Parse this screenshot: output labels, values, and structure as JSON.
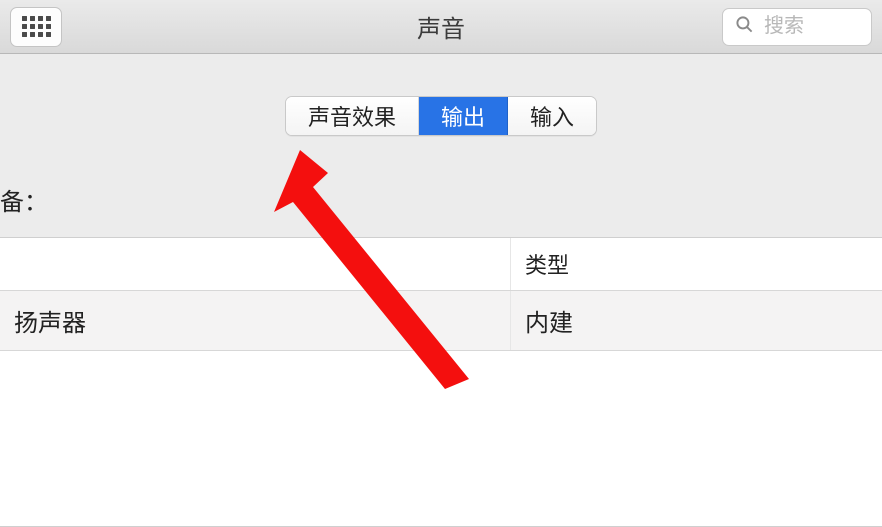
{
  "window": {
    "title": "声音"
  },
  "search": {
    "placeholder": "搜索",
    "value": ""
  },
  "tabs": [
    {
      "label": "声音效果",
      "active": false
    },
    {
      "label": "输出",
      "active": true
    },
    {
      "label": "输入",
      "active": false
    }
  ],
  "section_label": "备：",
  "table": {
    "headers": {
      "col2": "类型"
    },
    "rows": [
      {
        "col1": "扬声器",
        "col2": "内建"
      }
    ]
  },
  "colors": {
    "accent": "#2873e6",
    "arrow": "#f40f0e"
  }
}
